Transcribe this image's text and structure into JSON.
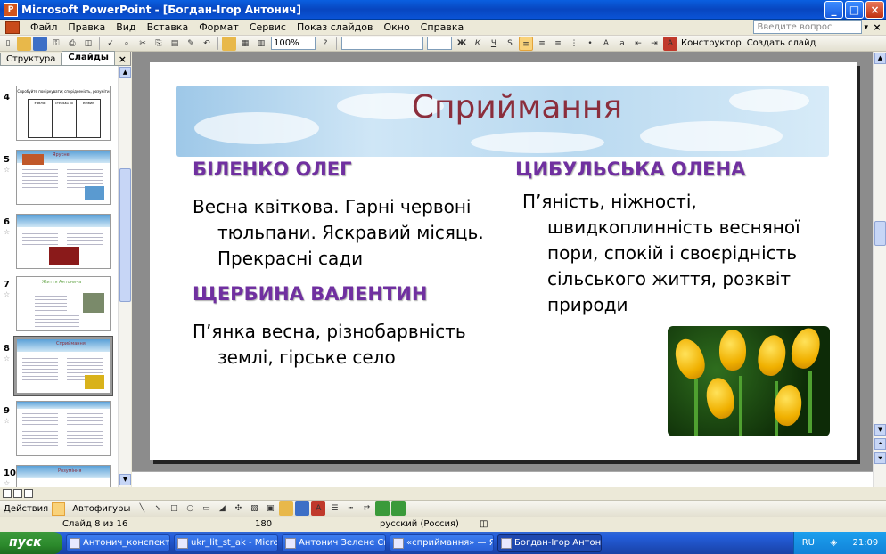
{
  "window": {
    "title": "Microsoft PowerPoint - [Богдан-Ігор Антонич]",
    "app_icon": "powerpoint-icon"
  },
  "menu": {
    "items": [
      "Файл",
      "Правка",
      "Вид",
      "Вставка",
      "Формат",
      "Сервис",
      "Показ слайдов",
      "Окно",
      "Справка"
    ],
    "help_placeholder": "Введите вопрос"
  },
  "toolbar": {
    "zoom": "100%",
    "konstruktor": "Конструктор",
    "create_slide": "Создать слайд"
  },
  "left_pane": {
    "tabs": [
      "Структура",
      "Слайды"
    ],
    "slides": [
      {
        "num": "4",
        "title": "Спробуйте поміркувати; спорідненість, розуміти",
        "cols": [
          "З'ЯВЛЯЄ",
          "СТРІЛЬБА ЗО",
          "РОЗВИЄ"
        ]
      },
      {
        "num": "5",
        "title": "Ярусне"
      },
      {
        "num": "6",
        "title": ""
      },
      {
        "num": "7",
        "title": "Життя Антонича"
      },
      {
        "num": "8",
        "title": "Сприймання"
      },
      {
        "num": "9",
        "title": ""
      },
      {
        "num": "10",
        "title": "Розуміння"
      }
    ]
  },
  "slide": {
    "title": "Сприймання",
    "left": {
      "name1": "БІЛЕНКО ОЛЕГ",
      "text1": "Весна квіткова. Гарні червоні тюльпани. Яскравий місяць. Прекрасні сади",
      "name2": "ЩЕРБИНА ВАЛЕНТИН",
      "text2": "П’янка весна, різнобарвність землі, гірське село"
    },
    "right": {
      "name1": "ЦИБУЛЬСЬКА ОЛЕНА",
      "text1": "П’яність, ніжності, швидкоплинність весняної пори, спокій і своєрідність сільського життя, розквіт природи"
    },
    "image": "yellow-tulips-photo"
  },
  "drawing_toolbar": {
    "actions": "Действия",
    "autoshapes": "Автофигуры"
  },
  "status": {
    "slide": "Слайд 8 из 16",
    "design": "180",
    "lang": "русский (Россия)"
  },
  "taskbar": {
    "start": "пуск",
    "tasks": [
      "Антонич_конспект -...",
      "ukr_lit_st_ak - Micros...",
      "Антонич Зелене Єва...",
      "«сприймання» — Ян...",
      "Богдан-Ігор Антонич"
    ],
    "lang": "RU",
    "time": "21:09"
  },
  "colors": {
    "name_purple": "#7030a0",
    "title_red": "#8b2e3c",
    "xp_blue": "#0a5fe0"
  }
}
